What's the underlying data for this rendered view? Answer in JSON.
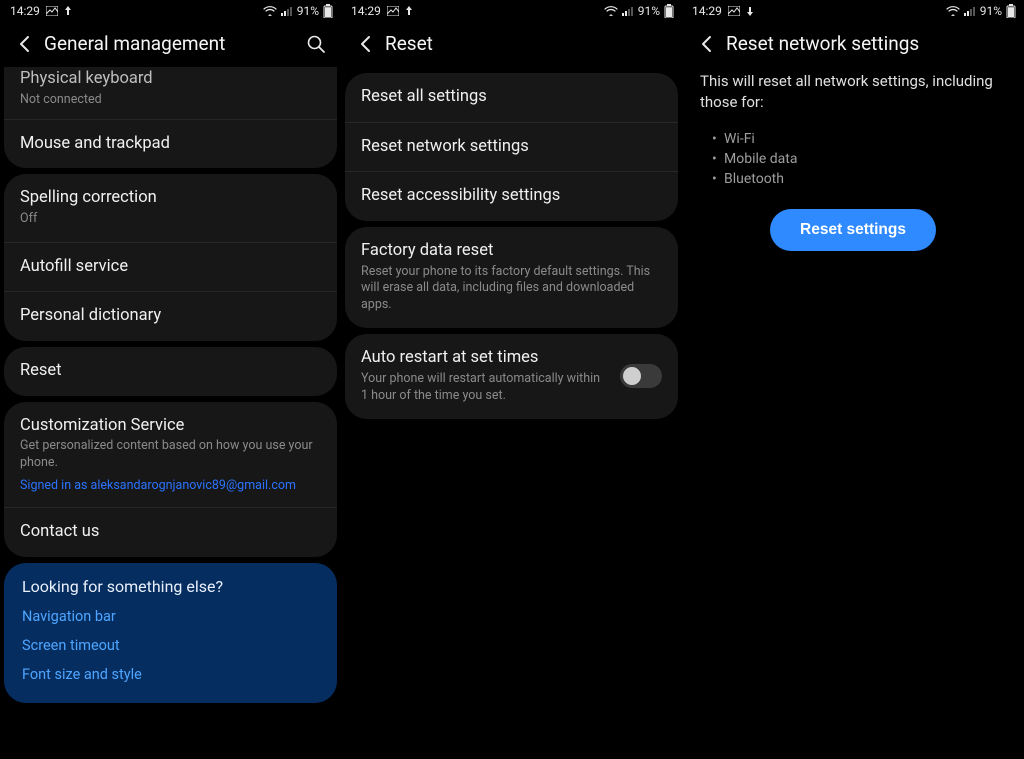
{
  "status": {
    "time": "14:29",
    "battery": "91%"
  },
  "pane1": {
    "title": "General management",
    "physical_keyboard": {
      "label": "Physical keyboard",
      "sub": "Not connected"
    },
    "mouse_trackpad": {
      "label": "Mouse and trackpad"
    },
    "spelling": {
      "label": "Spelling correction",
      "sub": "Off"
    },
    "autofill": {
      "label": "Autofill service"
    },
    "personal_dict": {
      "label": "Personal dictionary"
    },
    "reset": {
      "label": "Reset"
    },
    "customization": {
      "label": "Customization Service",
      "sub": "Get personalized content based on how you use your phone.",
      "signed": "Signed in as aleksandarognjanovic89@gmail.com"
    },
    "contact": {
      "label": "Contact us"
    },
    "help": {
      "question": "Looking for something else?",
      "link1": "Navigation bar",
      "link2": "Screen timeout",
      "link3": "Font size and style"
    }
  },
  "pane2": {
    "title": "Reset",
    "reset_all": {
      "label": "Reset all settings"
    },
    "reset_network": {
      "label": "Reset network settings"
    },
    "reset_accessibility": {
      "label": "Reset accessibility settings"
    },
    "factory": {
      "label": "Factory data reset",
      "sub": "Reset your phone to its factory default settings. This will erase all data, including files and downloaded apps."
    },
    "auto_restart": {
      "label": "Auto restart at set times",
      "sub": "Your phone will restart automatically within 1 hour of the time you set."
    }
  },
  "pane3": {
    "title": "Reset network settings",
    "desc": "This will reset all network settings, including those for:",
    "bullets": {
      "b1": "Wi-Fi",
      "b2": "Mobile data",
      "b3": "Bluetooth"
    },
    "button": "Reset settings"
  }
}
